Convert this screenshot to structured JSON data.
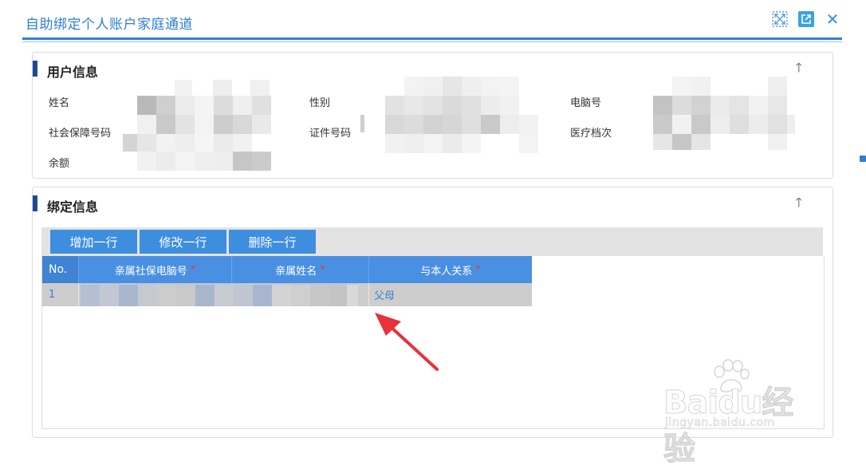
{
  "window": {
    "title": "自助绑定个人账户家庭通道",
    "icons": [
      "fit-screen-icon",
      "popout-icon",
      "close-icon"
    ]
  },
  "user_info": {
    "title": "用户信息",
    "collapse_icon": "arrow-up-icon",
    "fields": {
      "name_label": "姓名",
      "gender_label": "性别",
      "computer_no_label": "电脑号",
      "social_security_label": "社会保障号码",
      "id_no_label": "证件号码",
      "medical_level_label": "医疗档次",
      "balance_label": "余额"
    }
  },
  "bind_info": {
    "title": "绑定信息",
    "collapse_icon": "arrow-up-icon",
    "toolbar": {
      "add_label": "增加一行",
      "edit_label": "修改一行",
      "delete_label": "删除一行"
    },
    "grid": {
      "columns": [
        {
          "label": "No.",
          "required": false
        },
        {
          "label": "亲属社保电脑号",
          "required": true
        },
        {
          "label": "亲属姓名",
          "required": true
        },
        {
          "label": "与本人关系",
          "required": true
        }
      ],
      "required_mark": "*",
      "rows": [
        {
          "no": "1",
          "relation": "父母"
        }
      ]
    }
  },
  "watermark": {
    "brand": "Baidu经验",
    "url": "jingyan.baidu.com"
  },
  "colors": {
    "accent": "#2d83d7",
    "grid_header": "#4a90e2",
    "button": "#3e8ee0",
    "panel_bar": "#1e4b8f",
    "annotation_arrow": "#e8313a"
  }
}
